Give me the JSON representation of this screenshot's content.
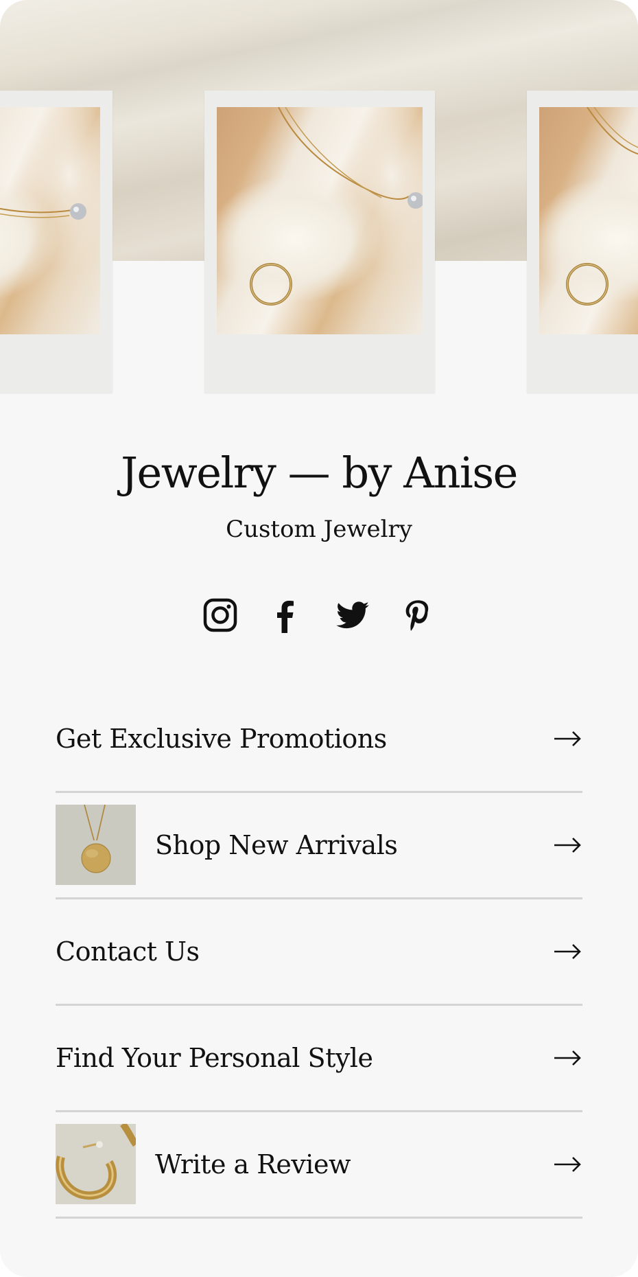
{
  "profile": {
    "title": "Jewelry — by Anise",
    "subtitle": "Custom Jewelry"
  },
  "socials": [
    {
      "name": "instagram-icon"
    },
    {
      "name": "facebook-icon"
    },
    {
      "name": "twitter-icon"
    },
    {
      "name": "pinterest-icon"
    }
  ],
  "links": [
    {
      "label": "Get Exclusive Promotions",
      "thumbnail": null
    },
    {
      "label": "Shop New Arrivals",
      "thumbnail": "gold-pendant-necklace"
    },
    {
      "label": "Contact Us",
      "thumbnail": null
    },
    {
      "label": "Find Your Personal Style",
      "thumbnail": null
    },
    {
      "label": "Write a Review",
      "thumbnail": "gold-hoop-earrings"
    }
  ],
  "colors": {
    "text": "#111111",
    "background": "#f7f7f7",
    "divider": "#d4d4d4",
    "hero_fabric": "#e6e0d3"
  }
}
